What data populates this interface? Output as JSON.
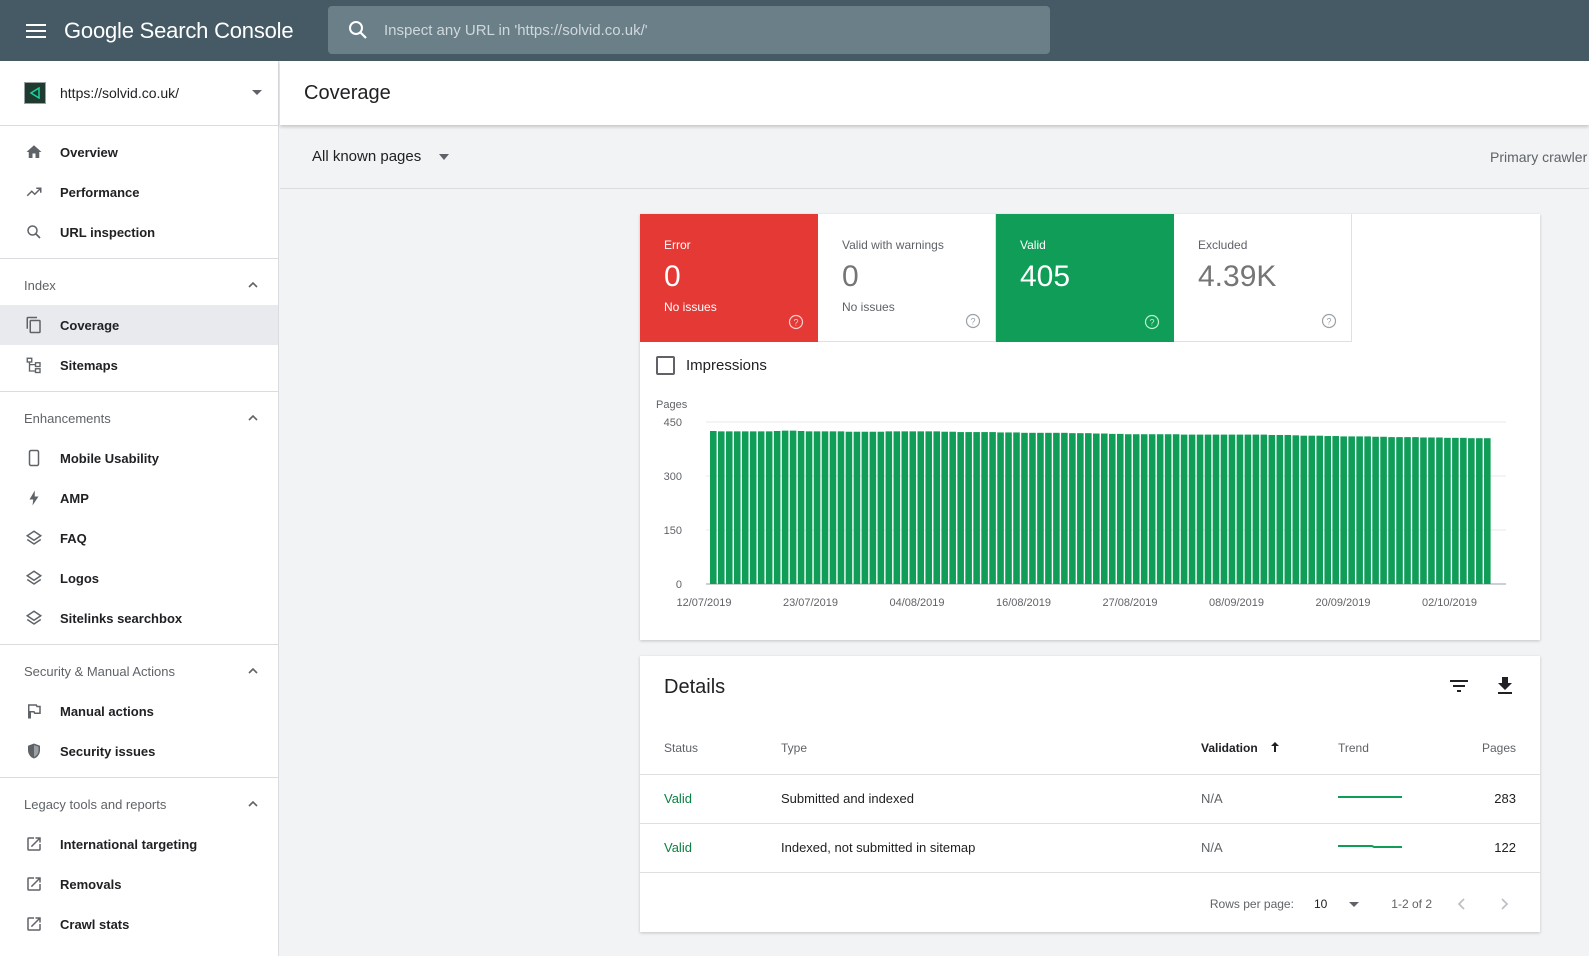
{
  "topbar": {
    "app_title": "Google Search Console",
    "search_placeholder": "Inspect any URL in 'https://solvid.co.uk/'"
  },
  "sidebar": {
    "property_url": "https://solvid.co.uk/",
    "top_items": [
      {
        "label": "Overview",
        "icon": "home-icon"
      },
      {
        "label": "Performance",
        "icon": "trending-up-icon"
      },
      {
        "label": "URL inspection",
        "icon": "search-icon"
      }
    ],
    "groups": [
      {
        "heading": "Index",
        "items": [
          {
            "label": "Coverage",
            "icon": "copy-icon",
            "active": true
          },
          {
            "label": "Sitemaps",
            "icon": "sitemap-icon"
          }
        ]
      },
      {
        "heading": "Enhancements",
        "items": [
          {
            "label": "Mobile Usability",
            "icon": "phone-icon"
          },
          {
            "label": "AMP",
            "icon": "bolt-icon"
          },
          {
            "label": "FAQ",
            "icon": "layers-icon"
          },
          {
            "label": "Logos",
            "icon": "layers-icon"
          },
          {
            "label": "Sitelinks searchbox",
            "icon": "layers-icon"
          }
        ]
      },
      {
        "heading": "Security & Manual Actions",
        "items": [
          {
            "label": "Manual actions",
            "icon": "flag-icon"
          },
          {
            "label": "Security issues",
            "icon": "shield-icon"
          }
        ]
      },
      {
        "heading": "Legacy tools and reports",
        "items": [
          {
            "label": "International targeting",
            "icon": "external-link-icon"
          },
          {
            "label": "Removals",
            "icon": "external-link-icon"
          },
          {
            "label": "Crawl stats",
            "icon": "external-link-icon"
          }
        ]
      }
    ]
  },
  "main": {
    "title": "Coverage",
    "filter": "All known pages",
    "crawler": "Primary crawler"
  },
  "tiles": [
    {
      "label": "Error",
      "value": "0",
      "sub": "No issues",
      "kind": "error",
      "color": "#e53935"
    },
    {
      "label": "Valid with warnings",
      "value": "0",
      "sub": "No issues",
      "kind": "warn"
    },
    {
      "label": "Valid",
      "value": "405",
      "sub": "",
      "kind": "valid",
      "color": "#0f9d58"
    },
    {
      "label": "Excluded",
      "value": "4.39K",
      "sub": "",
      "kind": "excl"
    }
  ],
  "impressions_label": "Impressions",
  "chart_data": {
    "type": "bar",
    "ylabel": "Pages",
    "ylim": [
      0,
      450
    ],
    "yticks": [
      0,
      150,
      300,
      450
    ],
    "xticks": [
      "12/07/2019",
      "23/07/2019",
      "04/08/2019",
      "16/08/2019",
      "27/08/2019",
      "08/09/2019",
      "20/09/2019",
      "02/10/2019"
    ],
    "color": "#0f9d58",
    "series": [
      {
        "values": [
          425,
          424,
          424,
          424,
          424,
          424,
          424,
          424,
          425,
          426,
          426,
          425,
          424,
          424,
          424,
          424,
          424,
          423,
          423,
          423,
          423,
          423,
          424,
          424,
          424,
          424,
          424,
          424,
          424,
          423,
          423,
          422,
          422,
          422,
          422,
          422,
          421,
          421,
          421,
          420,
          420,
          420,
          420,
          420,
          420,
          419,
          419,
          419,
          418,
          418,
          417,
          417,
          416,
          416,
          416,
          416,
          416,
          416,
          416,
          415,
          415,
          415,
          415,
          415,
          415,
          415,
          415,
          415,
          415,
          415,
          414,
          414,
          414,
          413,
          412,
          412,
          412,
          411,
          411,
          410,
          410,
          410,
          410,
          409,
          409,
          408,
          408,
          408,
          408,
          407,
          407,
          407,
          406,
          406,
          406,
          405,
          405,
          405
        ]
      }
    ]
  },
  "details": {
    "title": "Details",
    "columns": {
      "status": "Status",
      "type": "Type",
      "validation": "Validation",
      "trend": "Trend",
      "pages": "Pages"
    },
    "rows": [
      {
        "status": "Valid",
        "type": "Submitted and indexed",
        "validation": "N/A",
        "pages": "283"
      },
      {
        "status": "Valid",
        "type": "Indexed, not submitted in sitemap",
        "validation": "N/A",
        "pages": "122"
      }
    ],
    "pager": {
      "rows_per_page_label": "Rows per page:",
      "rows_per_page": "10",
      "range": "1-2 of 2"
    }
  }
}
